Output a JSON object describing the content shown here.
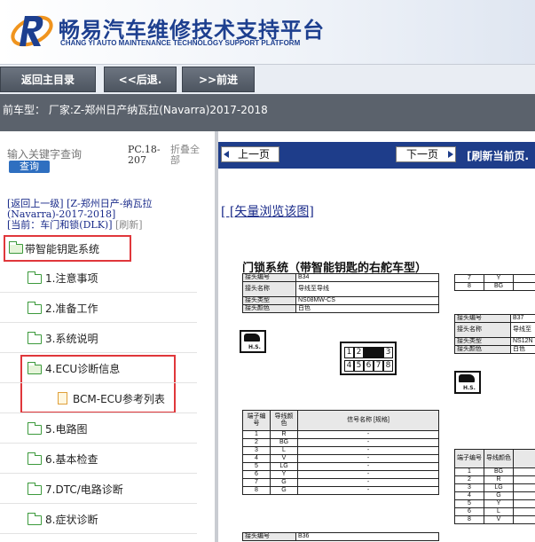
{
  "header": {
    "brand_cn": "畅易汽车维修技术支持平台",
    "brand_en": "CHANG YI AUTO MAINTENANCE TECHNOLOGY SUPPORT PLATFORM",
    "logo_icon": "cy-r-logo-icon",
    "brand_color": "#1d3f8f",
    "logo_orange": "#f0941e"
  },
  "nav": {
    "home": "返回主目录",
    "back": "<<后退.",
    "forward": ">>前进"
  },
  "vehicle": {
    "text": "前车型：  厂家:Z-郑州日产纳瓦拉(Navarra)2017-2018"
  },
  "search": {
    "placeholder": "输入关键字查询",
    "button": "查询",
    "pc_code": "PC.18-207",
    "fold_all": "折叠全部"
  },
  "breadcrumb": {
    "up": "[返回上一级]",
    "model": "[Z-郑州日产-纳瓦拉(Navarra)-2017-2018]",
    "current": "[当前：车门和锁(DLK)]",
    "refresh": "[刷新]"
  },
  "tree": {
    "root": "带智能钥匙系统",
    "items": [
      {
        "label": "1.注意事项"
      },
      {
        "label": "2.准备工作"
      },
      {
        "label": "3.系统说明"
      },
      {
        "label": "4.ECU诊断信息"
      },
      {
        "label": "BCM-ECU参考列表"
      },
      {
        "label": "5.电路图"
      },
      {
        "label": "6.基本检查"
      },
      {
        "label": "7.DTC/电路诊断"
      },
      {
        "label": "8.症状诊断"
      }
    ]
  },
  "pager": {
    "prev": "上一页",
    "next": "下一页",
    "refresh": "[刷新当前页."
  },
  "content": {
    "vector_link": "[ [矢量浏览该图]",
    "diagram": {
      "title": "门锁系统（带智能钥匙的右舵车型）",
      "conn1": {
        "no_label": "接头编号",
        "no": "B34",
        "name_label": "接头名称",
        "name": "导线至导线",
        "type_label": "接头类型",
        "type": "NS08MW-CS",
        "color_label": "接头颜色",
        "color": "白色"
      },
      "conn2": {
        "no_label": "接头编号",
        "no": "B37",
        "name_label": "接头名称",
        "name": "导线至",
        "type_label": "接头类型",
        "type": "NS12N",
        "color_label": "接头颜色",
        "color": "白色"
      },
      "conn3": {
        "no_label": "接头编号",
        "no": "B36"
      },
      "top_right_rows": [
        {
          "pin": "7",
          "color": "Y"
        },
        {
          "pin": "8",
          "color": "BG"
        }
      ],
      "pins_top": [
        "1",
        "2",
        "",
        "3"
      ],
      "pins_bottom": [
        "4",
        "5",
        "6",
        "7",
        "8"
      ],
      "hs_label": "H.S.",
      "main_table": {
        "headers": [
          "端子编号",
          "导线颜色",
          "信号名称 [规格]"
        ],
        "rows": [
          {
            "pin": "1",
            "color": "R",
            "signal": "-"
          },
          {
            "pin": "2",
            "color": "BG",
            "signal": "-"
          },
          {
            "pin": "3",
            "color": "L",
            "signal": "-"
          },
          {
            "pin": "4",
            "color": "V",
            "signal": "-"
          },
          {
            "pin": "5",
            "color": "LG",
            "signal": "-"
          },
          {
            "pin": "6",
            "color": "Y",
            "signal": "-"
          },
          {
            "pin": "7",
            "color": "G",
            "signal": "-"
          },
          {
            "pin": "8",
            "color": "G",
            "signal": "-"
          }
        ]
      },
      "right_table": {
        "headers": [
          "端子编号",
          "导线颜色"
        ],
        "rows": [
          {
            "pin": "1",
            "color": "BG"
          },
          {
            "pin": "2",
            "color": "R"
          },
          {
            "pin": "3",
            "color": "LG"
          },
          {
            "pin": "4",
            "color": "G"
          },
          {
            "pin": "5",
            "color": "Y"
          },
          {
            "pin": "6",
            "color": "L"
          },
          {
            "pin": "8",
            "color": "V"
          }
        ]
      }
    }
  },
  "colors": {
    "nav_bg": "#5b626c",
    "pager_bg": "#1e3d8a",
    "highlight_border": "#e0373b",
    "link": "#1a2b8a",
    "folder": "#3c9a3c"
  }
}
